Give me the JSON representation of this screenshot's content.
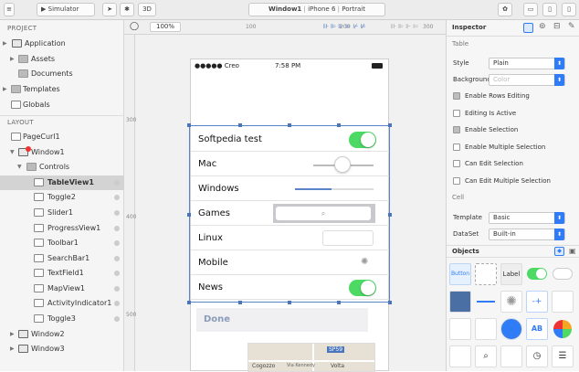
{
  "toolbar": {
    "scheme": "Simulator",
    "view_3d": "3D",
    "breadcrumb": [
      "Window1",
      "iPhone 6",
      "Portrait"
    ]
  },
  "sidebar": {
    "project_header": "PROJECT",
    "project_items": [
      "Application",
      "Assets",
      "Documents",
      "Templates",
      "Globals"
    ],
    "layout_header": "LAYOUT",
    "tree": [
      "PageCurl1",
      "Window1",
      "Controls",
      "TableView1",
      "Toggle2",
      "Slider1",
      "ProgressView1",
      "Toolbar1",
      "SearchBar1",
      "TextField1",
      "MapView1",
      "ActivityIndicator1",
      "Toggle3",
      "Window2",
      "Window3"
    ]
  },
  "canvas": {
    "zoom": "100%",
    "ruler_top": [
      "100",
      "200",
      "300"
    ],
    "ruler_left": [
      "300",
      "400",
      "500"
    ],
    "status": {
      "carrier": "●●●●● Creo",
      "time": "7:58 PM"
    },
    "rows": [
      "Softpedia test",
      "Mac",
      "Windows",
      "Games",
      "Linux",
      "Mobile",
      "News"
    ],
    "done_label": "Done",
    "map_labels": [
      "Cogozzo",
      "Via Kennedy",
      "Volta",
      "SP59"
    ]
  },
  "inspector": {
    "title": "Inspector",
    "table_header": "Table",
    "style_label": "Style",
    "style_value": "Plain",
    "background_label": "Background",
    "background_placeholder": "Color",
    "checks": [
      {
        "label": "Enable Rows Editing",
        "on": true
      },
      {
        "label": "Editing Is Active",
        "on": false
      },
      {
        "label": "Enable Selection",
        "on": true
      },
      {
        "label": "Enable Multiple Selection",
        "on": false
      },
      {
        "label": "Can Edit Selection",
        "on": false
      },
      {
        "label": "Can Edit Multiple Selection",
        "on": false
      }
    ],
    "cell_header": "Cell",
    "template_label": "Template",
    "template_value": "Basic",
    "dataset_label": "DataSet",
    "dataset_value": "Built-in",
    "objects_header": "Objects",
    "obj_button": "Button",
    "obj_label": "Label",
    "obj_ab": "AB"
  },
  "colors": {
    "accent": "#2f7cf6",
    "switch_on": "#4cd964",
    "selection": "#5a84c8"
  }
}
